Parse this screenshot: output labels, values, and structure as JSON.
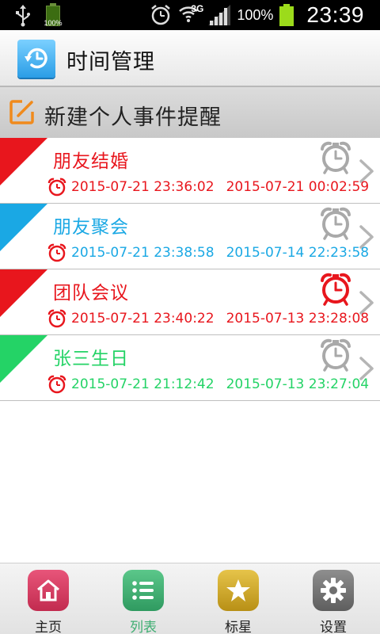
{
  "status_bar": {
    "battery_small_pct": "100%",
    "network": "3G",
    "battery_pct": "100%",
    "time": "23:39",
    "colors": {
      "bg": "#000000",
      "battery": "#9cdb1b"
    }
  },
  "header": {
    "title": "时间管理",
    "icon": "clock-history-icon",
    "color": "#2a9de6"
  },
  "new_reminder": {
    "label": "新建个人事件提醒",
    "icon": "edit-square-icon",
    "color": "#f08a1c"
  },
  "events": [
    {
      "title": "朋友结婚",
      "time_start": "2015-07-21 23:36:02",
      "time_end": "2015-07-21 00:02:59",
      "color": "#e8161d",
      "alarm_active": false
    },
    {
      "title": "朋友聚会",
      "time_start": "2015-07-21 23:38:58",
      "time_end": "2015-07-14 22:23:58",
      "color": "#1aa8e4",
      "alarm_active": false
    },
    {
      "title": "团队会议",
      "time_start": "2015-07-21 23:40:22",
      "time_end": "2015-07-13 23:28:08",
      "color": "#e8161d",
      "alarm_active": true
    },
    {
      "title": "张三生日",
      "time_start": "2015-07-21 21:12:42",
      "time_end": "2015-07-13 23:27:04",
      "color": "#24d366",
      "alarm_active": false
    }
  ],
  "bottom_nav": [
    {
      "label": "主页",
      "icon": "home-icon",
      "color": "#d53a5e",
      "active": false
    },
    {
      "label": "列表",
      "icon": "list-icon",
      "color": "#3fae72",
      "active": true
    },
    {
      "label": "标星",
      "icon": "star-icon",
      "color": "#d1a722",
      "active": false
    },
    {
      "label": "设置",
      "icon": "gear-icon",
      "color": "#7a7a7a",
      "active": false
    }
  ],
  "active_label_color": "#3fae72"
}
